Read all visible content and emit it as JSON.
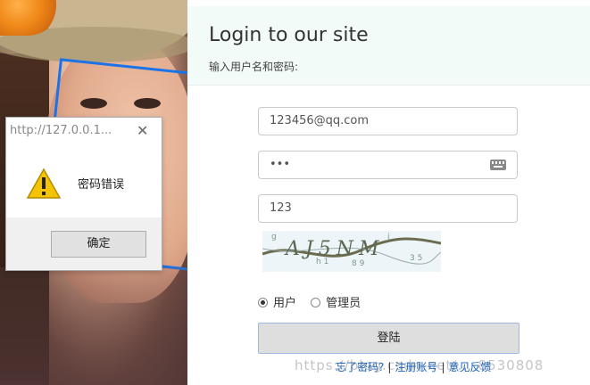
{
  "login": {
    "title": "Login to our site",
    "subtitle": "输入用户名和密码:",
    "username_value": "123456@qq.com",
    "password_value": "•••",
    "captcha_input_value": "123",
    "captcha_text": "AJ5NM",
    "role_user_label": "用户",
    "role_admin_label": "管理员",
    "role_selected": "用户",
    "submit_label": "登陆",
    "forgot_label": "忘了密码?",
    "register_label": "注册账号",
    "feedback_label": "意见反馈",
    "separator": "|"
  },
  "watermark": "https://blog.csdn.net/... 8530808",
  "dialog": {
    "title": "http://127.0.0.1...",
    "message": "密码错误",
    "ok_label": "确定",
    "close_symbol": "✕"
  },
  "colors": {
    "detect_box": "#1a73e8",
    "header_bg": "#f2fbf8",
    "link": "#1a5fb4"
  }
}
